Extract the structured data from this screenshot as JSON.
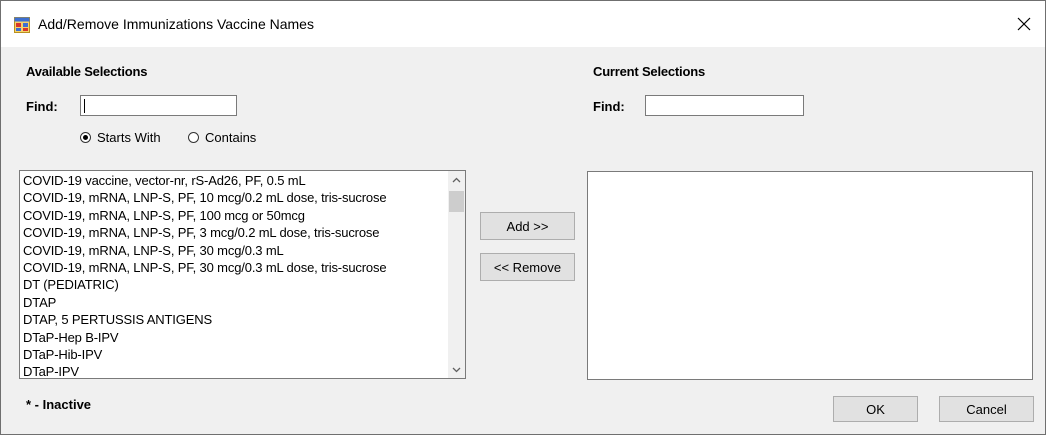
{
  "window": {
    "title": "Add/Remove Immunizations Vaccine Names",
    "close_glyph": "✕"
  },
  "available": {
    "heading": "Available Selections",
    "find_label": "Find:",
    "find_value": "",
    "radio_starts_with": "Starts With",
    "radio_contains": "Contains",
    "selected_mode": "Starts With",
    "items": [
      "COVID-19 vaccine, vector-nr, rS-Ad26, PF, 0.5 mL",
      "COVID-19, mRNA, LNP-S, PF, 10 mcg/0.2 mL dose, tris-sucrose",
      "COVID-19, mRNA, LNP-S, PF, 100 mcg or 50mcg",
      "COVID-19, mRNA, LNP-S, PF, 3 mcg/0.2 mL dose, tris-sucrose",
      "COVID-19, mRNA, LNP-S, PF, 30 mcg/0.3 mL",
      "COVID-19, mRNA, LNP-S, PF, 30 mcg/0.3 mL dose, tris-sucrose",
      "DT (PEDIATRIC)",
      "DTAP",
      "DTAP, 5 PERTUSSIS ANTIGENS",
      "DTaP-Hep B-IPV",
      "DTaP-Hib-IPV",
      "DTaP-IPV"
    ]
  },
  "current": {
    "heading": "Current Selections",
    "find_label": "Find:",
    "find_value": "",
    "items": []
  },
  "buttons": {
    "add": "Add >>",
    "remove": "<< Remove",
    "ok": "OK",
    "cancel": "Cancel"
  },
  "legend": "* - Inactive",
  "icons": {
    "app": "app-window-icon",
    "close": "close-icon",
    "scroll_up": "chevron-up-icon",
    "scroll_down": "chevron-down-icon"
  }
}
